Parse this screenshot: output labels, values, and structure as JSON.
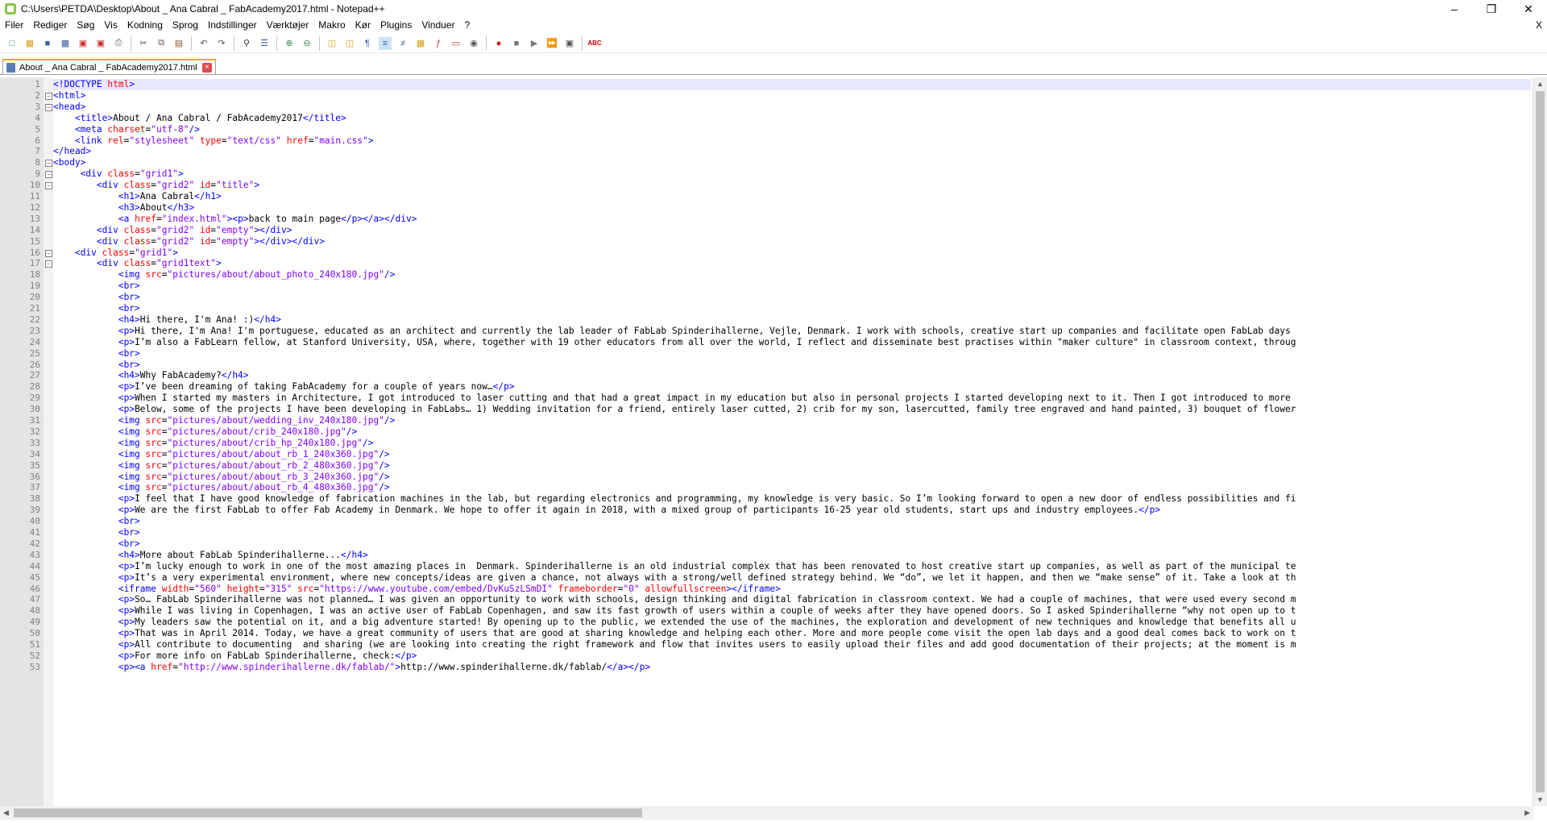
{
  "window": {
    "title": "C:\\Users\\PETDA\\Desktop\\About _ Ana Cabral _ FabAcademy2017.html - Notepad++",
    "controls": [
      "minimize",
      "restore",
      "close"
    ]
  },
  "menu": [
    "Filer",
    "Rediger",
    "Søg",
    "Vis",
    "Kodning",
    "Sprog",
    "Indstillinger",
    "Værktøjer",
    "Makro",
    "Kør",
    "Plugins",
    "Vinduer",
    "?"
  ],
  "menu_close": "X",
  "tab": {
    "label": "About _ Ana Cabral _ FabAcademy2017.html",
    "close": "×"
  },
  "colors": {
    "tag": "#0000ff",
    "attr": "#ff0000",
    "value": "#8000ff",
    "text": "#000000",
    "linenum": "#808080",
    "currentline": "#e8e8ff"
  },
  "code_lines": [
    {
      "n": 1,
      "fold": "",
      "t": "<!DOCTYPE html>"
    },
    {
      "n": 2,
      "fold": "-",
      "t": "<html>"
    },
    {
      "n": 3,
      "fold": "-",
      "t": "<head>"
    },
    {
      "n": 4,
      "fold": "",
      "t": "    <title>About / Ana Cabral / FabAcademy2017</title>"
    },
    {
      "n": 5,
      "fold": "",
      "t": "    <meta charset=\"utf-8\"/>"
    },
    {
      "n": 6,
      "fold": "",
      "t": "    <link rel=\"stylesheet\" type=\"text/css\" href=\"main.css\">"
    },
    {
      "n": 7,
      "fold": "",
      "t": "</head>"
    },
    {
      "n": 8,
      "fold": "-",
      "t": "<body>"
    },
    {
      "n": 9,
      "fold": "-",
      "t": "     <div class=\"grid1\">"
    },
    {
      "n": 10,
      "fold": "-",
      "t": "        <div class=\"grid2\" id=\"title\">"
    },
    {
      "n": 11,
      "fold": "",
      "t": "            <h1>Ana Cabral</h1>"
    },
    {
      "n": 12,
      "fold": "",
      "t": "            <h3>About</h3>"
    },
    {
      "n": 13,
      "fold": "",
      "t": "            <a href=\"index.html\"><p>back to main page</p></a></div>"
    },
    {
      "n": 14,
      "fold": "",
      "t": "        <div class=\"grid2\" id=\"empty\"></div>"
    },
    {
      "n": 15,
      "fold": "",
      "t": "        <div class=\"grid2\" id=\"empty\"></div></div>"
    },
    {
      "n": 16,
      "fold": "-",
      "t": "    <div class=\"grid1\">"
    },
    {
      "n": 17,
      "fold": "-",
      "t": "        <div class=\"grid1text\">"
    },
    {
      "n": 18,
      "fold": "",
      "t": "            <img src=\"pictures/about/about_photo_240x180.jpg\"/>"
    },
    {
      "n": 19,
      "fold": "",
      "t": "            <br>"
    },
    {
      "n": 20,
      "fold": "",
      "t": "            <br>"
    },
    {
      "n": 21,
      "fold": "",
      "t": "            <br>"
    },
    {
      "n": 22,
      "fold": "",
      "t": "            <h4>Hi there, I'm Ana! :)</h4>"
    },
    {
      "n": 23,
      "fold": "",
      "t": "            <p>Hi there, I'm Ana! I'm portuguese, educated as an architect and currently the lab leader of FabLab Spinderihallerne, Vejle, Denmark. I work with schools, creative start up companies and facilitate open FabLab days"
    },
    {
      "n": 24,
      "fold": "",
      "t": "            <p>I’m also a FabLearn fellow, at Stanford University, USA, where, together with 19 other educators from all over the world, I reflect and disseminate best practises within \"maker culture\" in classroom context, throug"
    },
    {
      "n": 25,
      "fold": "",
      "t": "            <br>"
    },
    {
      "n": 26,
      "fold": "",
      "t": "            <br>"
    },
    {
      "n": 27,
      "fold": "",
      "t": "            <h4>Why FabAcademy?</h4>"
    },
    {
      "n": 28,
      "fold": "",
      "t": "            <p>I’ve been dreaming of taking FabAcademy for a couple of years now…</p>"
    },
    {
      "n": 29,
      "fold": "",
      "t": "            <p>When I started my masters in Architecture, I got introduced to laser cutting and that had a great impact in my education but also in personal projects I started developing next to it. Then I got introduced to more"
    },
    {
      "n": 30,
      "fold": "",
      "t": "            <p>Below, some of the projects I have been developing in FabLabs… 1) Wedding invitation for a friend, entirely laser cutted, 2) crib for my son, lasercutted, family tree engraved and hand painted, 3) bouquet of flower"
    },
    {
      "n": 31,
      "fold": "",
      "t": "            <img src=\"pictures/about/wedding_inv_240x180.jpg\"/>"
    },
    {
      "n": 32,
      "fold": "",
      "t": "            <img src=\"pictures/about/crib_240x180.jpg\"/>"
    },
    {
      "n": 33,
      "fold": "",
      "t": "            <img src=\"pictures/about/crib_hp_240x180.jpg\"/>"
    },
    {
      "n": 34,
      "fold": "",
      "t": "            <img src=\"pictures/about/about_rb_1_240x360.jpg\"/>"
    },
    {
      "n": 35,
      "fold": "",
      "t": "            <img src=\"pictures/about/about_rb_2_480x360.jpg\"/>"
    },
    {
      "n": 36,
      "fold": "",
      "t": "            <img src=\"pictures/about/about_rb_3_240x360.jpg\"/>"
    },
    {
      "n": 37,
      "fold": "",
      "t": "            <img src=\"pictures/about/about_rb_4_480x360.jpg\"/>"
    },
    {
      "n": 38,
      "fold": "",
      "t": "            <p>I feel that I have good knowledge of fabrication machines in the lab, but regarding electronics and programming, my knowledge is very basic. So I’m looking forward to open a new door of endless possibilities and fi"
    },
    {
      "n": 39,
      "fold": "",
      "t": "            <p>We are the first FabLab to offer Fab Academy in Denmark. We hope to offer it again in 2018, with a mixed group of participants 16-25 year old students, start ups and industry employees.</p>"
    },
    {
      "n": 40,
      "fold": "",
      "t": "            <br>"
    },
    {
      "n": 41,
      "fold": "",
      "t": "            <br>"
    },
    {
      "n": 42,
      "fold": "",
      "t": "            <br>"
    },
    {
      "n": 43,
      "fold": "",
      "t": "            <h4>More about FabLab Spinderihallerne...</h4>"
    },
    {
      "n": 44,
      "fold": "",
      "t": "            <p>I’m lucky enough to work in one of the most amazing places in  Denmark. Spinderihallerne is an old industrial complex that has been renovated to host creative start up companies, as well as part of the municipal te"
    },
    {
      "n": 45,
      "fold": "",
      "t": "            <p>It’s a very experimental environment, where new concepts/ideas are given a chance, not always with a strong/well defined strategy behind. We “do”, we let it happen, and then we “make sense” of it. Take a look at th"
    },
    {
      "n": 46,
      "fold": "",
      "t": "            <iframe width=\"560\" height=\"315\" src=\"https://www.youtube.com/embed/DvKuSzLSmDI\" frameborder=\"0\" allowfullscreen></iframe>"
    },
    {
      "n": 47,
      "fold": "",
      "t": "            <p>So… FabLab Spinderihallerne was not planned… I was given an opportunity to work with schools, design thinking and digital fabrication in classroom context. We had a couple of machines, that were used every second m"
    },
    {
      "n": 48,
      "fold": "",
      "t": "            <p>While I was living in Copenhagen, I was an active user of FabLab Copenhagen, and saw its fast growth of users within a couple of weeks after they have opened doors. So I asked Spinderihallerne “why not open up to t"
    },
    {
      "n": 49,
      "fold": "",
      "t": "            <p>My leaders saw the potential on it, and a big adventure started! By opening up to the public, we extended the use of the machines, the exploration and development of new techniques and knowledge that benefits all u"
    },
    {
      "n": 50,
      "fold": "",
      "t": "            <p>That was in April 2014. Today, we have a great community of users that are good at sharing knowledge and helping each other. More and more people come visit the open lab days and a good deal comes back to work on t"
    },
    {
      "n": 51,
      "fold": "",
      "t": "            <p>All contribute to documenting  and sharing (we are looking into creating the right framework and flow that invites users to easily upload their files and add good documentation of their projects; at the moment is m"
    },
    {
      "n": 52,
      "fold": "",
      "t": "            <p>For more info on FabLab Spinderihallerne, check:</p>"
    },
    {
      "n": 53,
      "fold": "",
      "t": "            <p><a href=\"http://www.spinderihallerne.dk/fablab/\">http://www.spinderihallerne.dk/fablab/</a></p>"
    }
  ]
}
